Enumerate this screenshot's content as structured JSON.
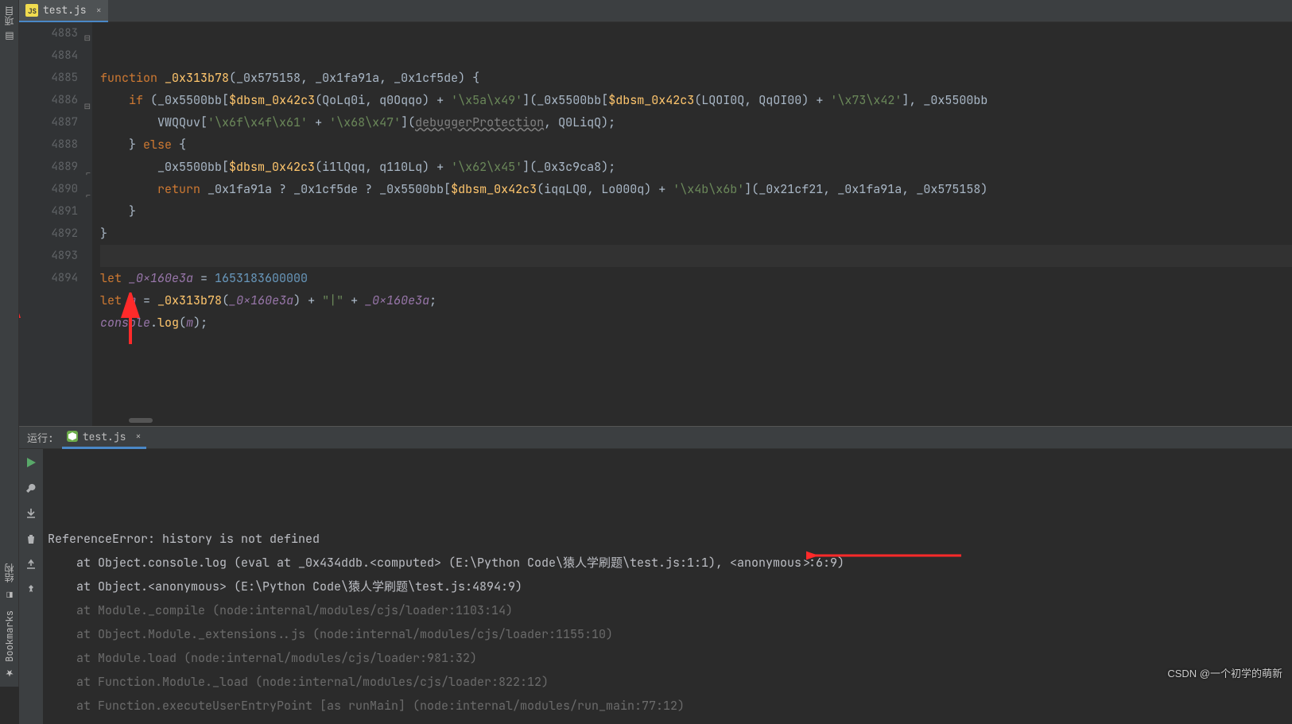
{
  "left_sidebar": {
    "project_tab": "项目",
    "structure_tab": "结构",
    "bookmarks_tab": "Bookmarks"
  },
  "tab": {
    "filename": "test.js",
    "icon_label": "JS"
  },
  "editor": {
    "lines": [
      {
        "n": 4883,
        "html": "<span class='kw'>function </span><span class='fn'>_0x313b78</span>(<span class='param'>_0x575158</span>, <span class='param'>_0x1fa91a</span>, <span class='param'>_0x1cf5de</span>) {"
      },
      {
        "n": 4884,
        "html": "    <span class='kw'>if </span>(<span class='id'>_0x5500bb</span>[<span class='fn'>$dbsm_0x42c3</span>(<span class='id'>QoLq0i</span>, <span class='id'>q0Oqqo</span>) + <span class='str'>'\\x5a\\x49'</span>](<span class='id'>_0x5500bb</span>[<span class='fn'>$dbsm_0x42c3</span>(<span class='id'>LQOI0Q</span>, <span class='id'>QqOI00</span>) + <span class='str'>'\\x73\\x42'</span>], <span class='id'>_0x5500bb</span>"
      },
      {
        "n": 4885,
        "html": "        <span class='id'>VWQQuv</span>[<span class='str'>'\\x6f\\x4f\\x61'</span> + <span class='str'>'\\x68\\x47'</span>](<span class='td'>debuggerProtection</span>, <span class='id'>Q0LiqQ</span>);"
      },
      {
        "n": 4886,
        "html": "    } <span class='kw'>else</span> {"
      },
      {
        "n": 4887,
        "html": "        <span class='id'>_0x5500bb</span>[<span class='fn'>$dbsm_0x42c3</span>(<span class='id'>i1lQqq</span>, <span class='id'>q110Lq</span>) + <span class='str'>'\\x62\\x45'</span>](<span class='id'>_0x3c9ca8</span>);"
      },
      {
        "n": 4888,
        "html": "        <span class='kw'>return </span><span class='id'>_0x1fa91a</span> ? <span class='id'>_0x1cf5de</span> ? <span class='id'>_0x5500bb</span>[<span class='fn'>$dbsm_0x42c3</span>(<span class='id'>iqqLQ0</span>, <span class='id'>Lo000q</span>) + <span class='str'>'\\x4b\\x6b'</span>](<span class='id'>_0x21cf21</span>, <span class='id'>_0x1fa91a</span>, <span class='id'>_0x575158</span>)"
      },
      {
        "n": 4889,
        "html": "    }"
      },
      {
        "n": 4890,
        "html": "}"
      },
      {
        "n": 4891,
        "html": "",
        "current": true
      },
      {
        "n": 4892,
        "html": "<span class='kw'>let </span><span class='purple it'>_0x160e3a</span> = <span class='num'>1653183600000</span>"
      },
      {
        "n": 4893,
        "html": "<span class='kw'>let </span><span class='purple it'>m</span> = <span class='fn'>_0x313b78</span>(<span class='purple it'>_0x160e3a</span>) + <span class='str'>\"|\"</span> + <span class='purple it'>_0x160e3a</span>;"
      },
      {
        "n": 4894,
        "html": "<span class='purple it'>console</span>.<span class='fn'>log</span>(<span class='purple it'>m</span>);"
      }
    ]
  },
  "run": {
    "label": "运行:",
    "tab_name": "test.js"
  },
  "console": {
    "lines": [
      {
        "text": "ReferenceError: history is not defined",
        "cls": ""
      },
      {
        "text": "    at Object.console.log (eval at _0x434ddb.<computed> (E:\\Python Code\\猿人学刷题\\test.js:1:1), <anonymous>:6:9)",
        "cls": ""
      },
      {
        "text": "    at Object.<anonymous> (E:\\Python Code\\猿人学刷题\\test.js:4894:9)",
        "cls": ""
      },
      {
        "text": "    at Module._compile (node:internal/modules/cjs/loader:1103:14)",
        "cls": "dim"
      },
      {
        "text": "    at Object.Module._extensions..js (node:internal/modules/cjs/loader:1155:10)",
        "cls": "dim"
      },
      {
        "text": "    at Module.load (node:internal/modules/cjs/loader:981:32)",
        "cls": "dim"
      },
      {
        "text": "    at Function.Module._load (node:internal/modules/cjs/loader:822:12)",
        "cls": "dim"
      },
      {
        "text": "    at Function.executeUserEntryPoint [as runMain] (node:internal/modules/run_main:77:12)",
        "cls": "dim"
      }
    ]
  },
  "watermark": "CSDN @一个初学的萌新"
}
